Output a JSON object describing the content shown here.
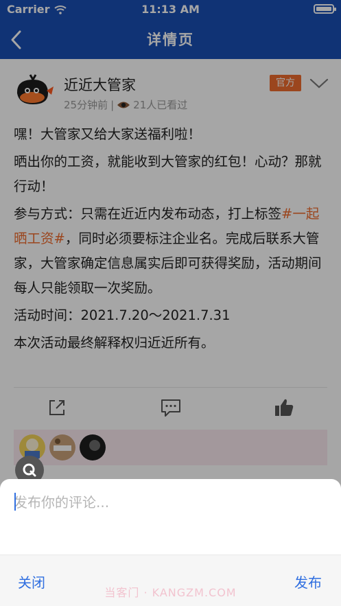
{
  "status_bar": {
    "carrier": "Carrier",
    "time": "11:13 AM"
  },
  "nav": {
    "title": "详情页"
  },
  "post": {
    "author": "近近大管家",
    "time_ago": "25分钟前",
    "separator": "|",
    "views": "21人已看过",
    "badge": "官方",
    "paragraphs": {
      "p1": "嘿！大管家又给大家送福利啦！",
      "p2": "晒出你的工资，就能收到大管家的红包！心动？那就行动！",
      "p3_before": "参与方式：只需在近近内发布动态，打上标签",
      "p3_hashtag": "#一起晒工资#",
      "p3_after": "，同时必须要标注企业名。完成后联系大管家，大管家确定信息属实后即可获得奖励，活动期间每人只能领取一次奖励。",
      "p4": "活动时间：2021.7.20～2021.7.31",
      "p5": "本次活动最终解释权归近近所有。"
    }
  },
  "comment_sheet": {
    "placeholder": "发布你的评论...",
    "close_label": "关闭",
    "publish_label": "发布",
    "watermark": "当客门 · KANGZM.COM"
  },
  "colors": {
    "nav_bg": "#1a4fb4",
    "accent": "#ef6c2e",
    "link": "#2f6ee0"
  }
}
